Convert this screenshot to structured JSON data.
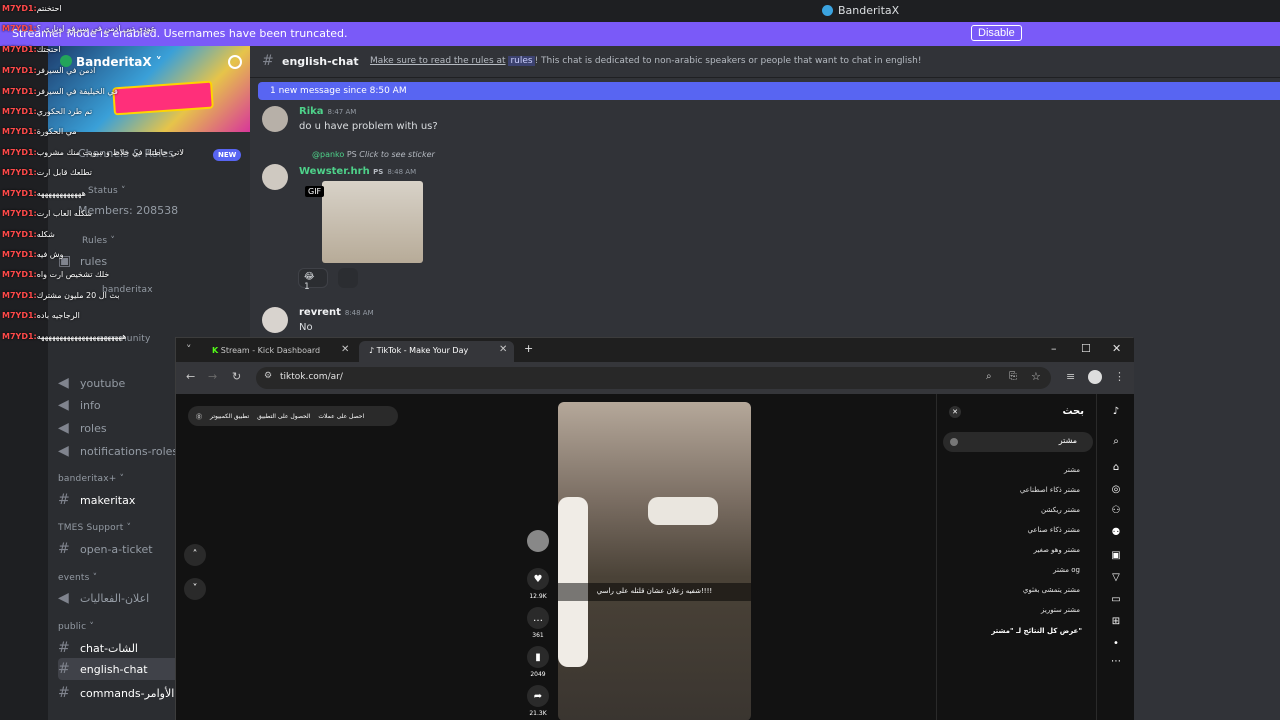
{
  "window": {
    "title": "BanderitaX"
  },
  "streamer_bar": {
    "message": "Streamer Mode is enabled. Usernames have been truncated.",
    "button": "Disable"
  },
  "server": {
    "name": "BanderitaX ˅"
  },
  "sidebar": {
    "channels_roles": "Channels & Roles",
    "new_badge": "NEW",
    "status": "Status ˅",
    "members": "Members: 208538",
    "rules_cat": "Rules ˅",
    "rules": "rules",
    "banderitax_cat": "banderitax",
    "community_cat": "community",
    "ch_youtube": "youtube",
    "ch_info": "info",
    "ch_roles": "roles",
    "ch_notif": "notifications-roles",
    "cat_plus": "banderitax+ ˅",
    "ch_maker": "makeritax",
    "cat_support": "TMES Support ˅",
    "ch_ticket": "open-a-ticket",
    "cat_events": "events ˅",
    "ch_events": "اعلان-الفعاليات",
    "cat_public": "public ˅",
    "ch_chat": "chat-الشات",
    "ch_english": "english-chat",
    "ch_commands": "commands-الأوامر"
  },
  "overlay": [
    {
      "user": "M7YD1:",
      "text": "احتخنتم"
    },
    {
      "user": "M7YD1:",
      "text": "عودي تبي ادمن في سيرفر اوناري ؟"
    },
    {
      "user": "M7YD1:",
      "text": "احتجتك"
    },
    {
      "user": "M7YD1:",
      "text": "ادمن في السيرفر"
    },
    {
      "user": "M7YD1:",
      "text": "في الخيليفة في السيرفر"
    },
    {
      "user": "M7YD1:",
      "text": "تم طرد الحكوري"
    },
    {
      "user": "M7YD1:",
      "text": "مي الحكورة"
    },
    {
      "user": "M7YD1:",
      "text": "لاتي حاطتك في خلاط و سويت منك مشروب"
    },
    {
      "user": "M7YD1:",
      "text": "تطلعك قابل ارت"
    },
    {
      "user": "M7YD1:",
      "text": "ههههههههههههه"
    },
    {
      "user": "M7YD1:",
      "text": "شكله العاب ارت"
    },
    {
      "user": "M7YD1:",
      "text": "شكله"
    },
    {
      "user": "M7YD1:",
      "text": "وش فيه"
    },
    {
      "user": "M7YD1:",
      "text": "خلك تشخيص ارت واه"
    },
    {
      "user": "M7YD1:",
      "text": "بث ال 20 مليون مشترك"
    },
    {
      "user": "M7YD1:",
      "text": "الرجاجيه باده"
    },
    {
      "user": "M7YD1:",
      "text": "هههههههههههههههههههههههه"
    }
  ],
  "channel": {
    "name": "english-chat",
    "topic_link": "Make sure to read the rules at",
    "topic_ch": "rules",
    "topic_rest": "! This chat is dedicated to non-arabic speakers or people that want to chat in english!"
  },
  "new_messages": "1 new message since 8:50 AM",
  "messages": [
    {
      "name": "Rika",
      "time": "8:47 AM",
      "text": "do u have problem with us?"
    },
    {
      "reply": "@panko",
      "reply_tag": "PS",
      "reply_text": "Click to see sticker",
      "name": "Wewster.hrh",
      "tag": "PS",
      "time": "8:48 AM",
      "gif": "GIF",
      "reaction": "1"
    },
    {
      "name": "revrent",
      "time": "8:48 AM",
      "text": "No"
    }
  ],
  "browser": {
    "tab1": "Stream - Kick Dashboard",
    "tab2": "TikTok - Make Your Day",
    "url": "tiktok.com/ar/"
  },
  "tiktok": {
    "promo": [
      "احصل على عملات",
      "الحصول على التطبيق",
      "تطبيق الكمبيوتر"
    ],
    "caption": "شفيه زعلان عشان قلتله على راسي!!!!",
    "likes": "12.9K",
    "comments": "361",
    "saves": "2049",
    "shares": "21.3K",
    "search_title": "بحث",
    "search_value": "مشتر",
    "suggestions": [
      "مشتر",
      "مشتر ذكاء اصطناعي",
      "مشتر ريكشن",
      "مشتر ذكاء صناعي",
      "مشتر وهو صغير",
      "مشتر og",
      "مشتر يتمشى بغثوي",
      "مشتر ستوريز"
    ],
    "see_all": "عرض كل النتائج لـ \"مشتر\""
  }
}
